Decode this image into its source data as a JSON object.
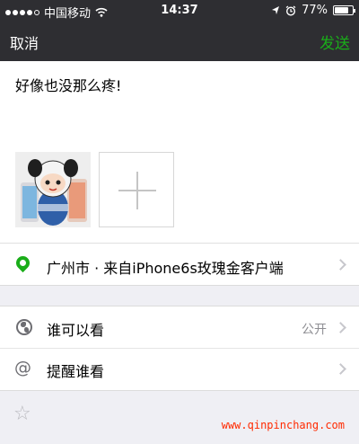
{
  "status_bar": {
    "carrier": "中国移动",
    "time": "14:37",
    "battery": "77%",
    "battery_level": 0.77,
    "signal_bars_filled": 4,
    "signal_bars_total": 5
  },
  "nav": {
    "cancel_label": "取消",
    "send_label": "发送"
  },
  "compose": {
    "text": "好像也没那么疼!"
  },
  "location": {
    "label": "广州市 · 来自iPhone6s玫瑰金客户端"
  },
  "visibility": {
    "label": "谁可以看",
    "value": "公开"
  },
  "remind": {
    "label": "提醒谁看"
  },
  "watermark": {
    "text": "www.qinpinchang.com"
  },
  "colors": {
    "accent_green": "#1aad19",
    "nav_background": "#2e2e32",
    "page_background": "#efeff4",
    "watermark_red": "#ff2a00"
  },
  "icons": {
    "location": "location-pin-icon",
    "visibility": "globe-icon",
    "remind": "at-icon",
    "bottom": "star-icon",
    "add": "plus-icon",
    "wifi": "wifi-icon",
    "location_services": "location-arrow-icon",
    "alarm": "alarm-icon"
  }
}
